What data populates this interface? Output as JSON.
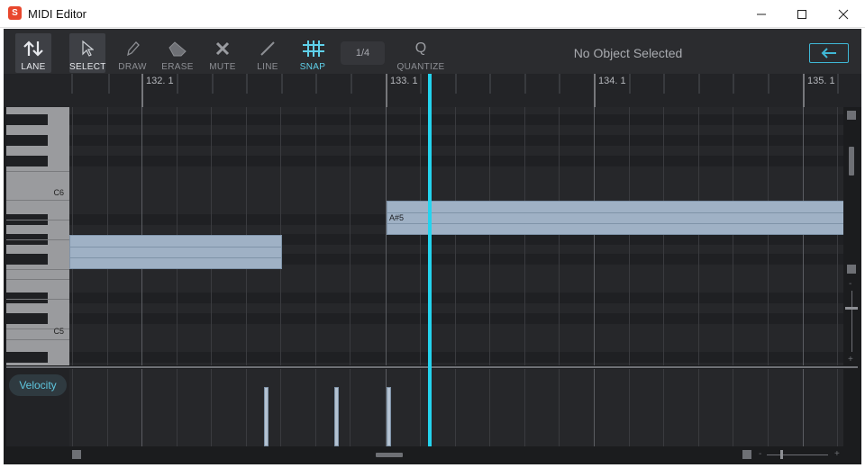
{
  "window": {
    "title": "MIDI Editor",
    "app_icon_glyph": "S"
  },
  "toolbar": {
    "tools": [
      {
        "id": "lane",
        "label": "LANE",
        "icon": "up-down-arrows-icon"
      },
      {
        "id": "select",
        "label": "SELECT",
        "icon": "cursor-arrow-icon"
      },
      {
        "id": "draw",
        "label": "DRAW",
        "icon": "pencil-icon"
      },
      {
        "id": "erase",
        "label": "ERASE",
        "icon": "eraser-icon"
      },
      {
        "id": "mute",
        "label": "MUTE",
        "icon": "x-mark-icon"
      },
      {
        "id": "line",
        "label": "LINE",
        "icon": "diagonal-line-icon"
      },
      {
        "id": "snap",
        "label": "SNAP",
        "icon": "grid-hash-icon"
      },
      {
        "id": "quantize",
        "label": "QUANTIZE",
        "icon": "q-letter-icon"
      }
    ],
    "snap_value": "1/4",
    "quantize_glyph": "Q",
    "status": "No Object Selected",
    "back_icon": "left-arrow-icon",
    "accent_color": "#23d3ee"
  },
  "ruler": {
    "markers": [
      "132. 1",
      "133. 1",
      "134. 1",
      "135. 1"
    ]
  },
  "keyboard": {
    "labels": {
      "c6": "C6",
      "c5": "C5"
    }
  },
  "notes": [
    {
      "pitch": "",
      "label": ""
    },
    {
      "pitch": "A#5",
      "label": "A#5"
    }
  ],
  "velocity_lane": {
    "label": "Velocity"
  },
  "scroll": {
    "zoom_minus": "-",
    "zoom_plus": "+"
  }
}
